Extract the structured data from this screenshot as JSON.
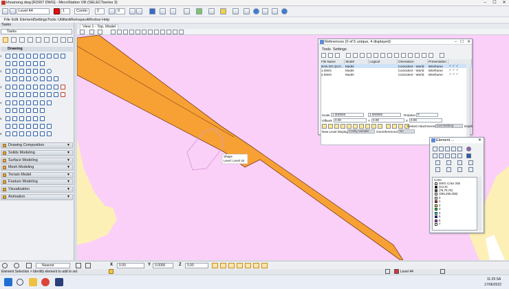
{
  "window": {
    "title": "khoanong.dwg [R2007 DWG] - MicroStation V8i (SELECTseries 3)",
    "minimize": "–",
    "maximize": "☐",
    "close": "✕"
  },
  "toolbar": {
    "level_combo": "Level 44",
    "color_index": "1",
    "linestyle": "Contin",
    "weight": "2",
    "transparency": "0"
  },
  "menu": [
    "File",
    "Edit",
    "Element",
    "Settings",
    "Tools",
    "Utilities",
    "Workspace",
    "Window",
    "Help"
  ],
  "tasks": {
    "header": "Tasks",
    "combo": "Tasks",
    "drawing_header": "Drawing",
    "groups": [
      "Drawing Composition",
      "Solids Modeling",
      "Surface Modeling",
      "Mesh Modeling",
      "Terrain Model",
      "Feature Modeling",
      "Visualization",
      "Animation"
    ],
    "row_numbers": [
      "1",
      "2",
      "3",
      "4",
      "5",
      "6"
    ]
  },
  "view": {
    "tab": "View 1 - Top, Model",
    "tooltip_line1": "Shape",
    "tooltip_line2": "Level: Level 44"
  },
  "references": {
    "title": "References (0 of 5 unique, 4 displayed)",
    "menu": [
      "Tools",
      "Settings"
    ],
    "columns": [
      "File Name",
      "Model",
      "Logical",
      "Orientation",
      "Presentation"
    ],
    "rows": [
      {
        "file": "BAN DO QUY...",
        "model": "Model",
        "logical": "",
        "orientation": "Coincident - World",
        "presentation": "Wireframe"
      },
      {
        "file": "1.DWG",
        "model": "Model",
        "logical": "",
        "orientation": "Coincident - World",
        "presentation": "Wireframe"
      },
      {
        "file": "2.DWG",
        "model": "Model",
        "logical": "",
        "orientation": "Coincident - World",
        "presentation": "Wireframe"
      }
    ],
    "scale_label": "Scale",
    "scale_a": "1.000000",
    "scale_b": "1.000000",
    "rotation_label": "Rotation",
    "rotation": "0",
    "offset_label": "Offset",
    "x_label": "X",
    "x_value": "0.00",
    "y_label": "Y",
    "y_value": "0.00",
    "z_label": "Z",
    "z_value": "0.00",
    "nested_label": "Nested Attachments:",
    "nested_value": "Live Nesting",
    "depth_label": "Depth",
    "new_level_label": "New Level Display:",
    "new_level_value": "Config Variable",
    "georef_label": "Georeferenced:",
    "georef_value": "No"
  },
  "element_panel": {
    "title": "Element ...",
    "color_label": "Color",
    "colors": [
      {
        "label": "DWG Color 255",
        "hex": "#f2f2f2"
      },
      {
        "label": "(0,0,0)",
        "hex": "#000000"
      },
      {
        "label": "(76,76,76)",
        "hex": "#4c4c4c"
      },
      {
        "label": "(255,255,255)",
        "hex": "#ffffff"
      },
      {
        "label": "0",
        "hex": "#ffffff"
      },
      {
        "label": "1",
        "hex": "#ff0000"
      },
      {
        "label": "2",
        "hex": "#ffff00"
      },
      {
        "label": "3",
        "hex": "#00ff00"
      },
      {
        "label": "4",
        "hex": "#00ffff"
      },
      {
        "label": "5",
        "hex": "#0000ff"
      },
      {
        "label": "6",
        "hex": "#ff00ff"
      },
      {
        "label": "7",
        "hex": "#ffffff"
      }
    ]
  },
  "status": {
    "prompt": "Element Selection > Identify element to add to set",
    "lock_mode": "Nearest",
    "x_value": "0.00",
    "y_value": "0.0000",
    "z_value": "0.00",
    "level": "Level 44"
  },
  "taskbar": {
    "time": "11:29 SA",
    "date": "17/06/2022"
  },
  "colors": {
    "background_fill": "#fbd0f8",
    "road_fill": "#f7a135",
    "road_edge": "#7a3a1a",
    "sand_fill": "#fdf0b6",
    "selection_outline": "#d49cd6",
    "accent": "#2b5ea8"
  }
}
